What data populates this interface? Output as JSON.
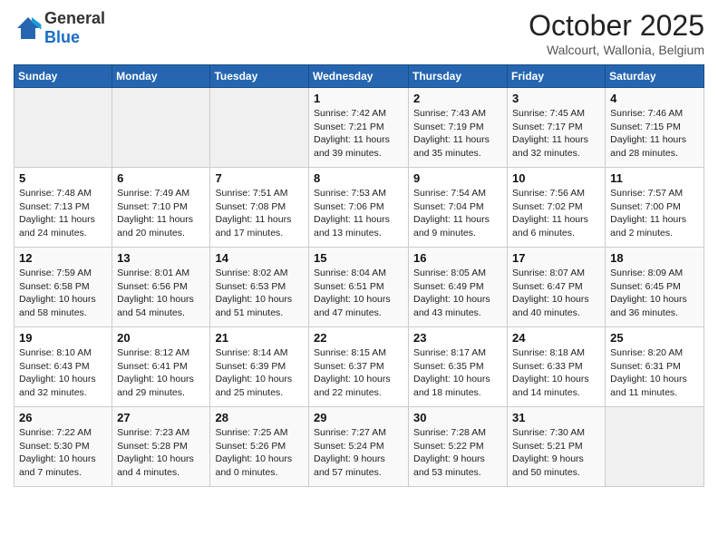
{
  "header": {
    "logo_general": "General",
    "logo_blue": "Blue",
    "month_title": "October 2025",
    "subtitle": "Walcourt, Wallonia, Belgium"
  },
  "days_of_week": [
    "Sunday",
    "Monday",
    "Tuesday",
    "Wednesday",
    "Thursday",
    "Friday",
    "Saturday"
  ],
  "weeks": [
    [
      {
        "day": "",
        "info": ""
      },
      {
        "day": "",
        "info": ""
      },
      {
        "day": "",
        "info": ""
      },
      {
        "day": "1",
        "info": "Sunrise: 7:42 AM\nSunset: 7:21 PM\nDaylight: 11 hours\nand 39 minutes."
      },
      {
        "day": "2",
        "info": "Sunrise: 7:43 AM\nSunset: 7:19 PM\nDaylight: 11 hours\nand 35 minutes."
      },
      {
        "day": "3",
        "info": "Sunrise: 7:45 AM\nSunset: 7:17 PM\nDaylight: 11 hours\nand 32 minutes."
      },
      {
        "day": "4",
        "info": "Sunrise: 7:46 AM\nSunset: 7:15 PM\nDaylight: 11 hours\nand 28 minutes."
      }
    ],
    [
      {
        "day": "5",
        "info": "Sunrise: 7:48 AM\nSunset: 7:13 PM\nDaylight: 11 hours\nand 24 minutes."
      },
      {
        "day": "6",
        "info": "Sunrise: 7:49 AM\nSunset: 7:10 PM\nDaylight: 11 hours\nand 20 minutes."
      },
      {
        "day": "7",
        "info": "Sunrise: 7:51 AM\nSunset: 7:08 PM\nDaylight: 11 hours\nand 17 minutes."
      },
      {
        "day": "8",
        "info": "Sunrise: 7:53 AM\nSunset: 7:06 PM\nDaylight: 11 hours\nand 13 minutes."
      },
      {
        "day": "9",
        "info": "Sunrise: 7:54 AM\nSunset: 7:04 PM\nDaylight: 11 hours\nand 9 minutes."
      },
      {
        "day": "10",
        "info": "Sunrise: 7:56 AM\nSunset: 7:02 PM\nDaylight: 11 hours\nand 6 minutes."
      },
      {
        "day": "11",
        "info": "Sunrise: 7:57 AM\nSunset: 7:00 PM\nDaylight: 11 hours\nand 2 minutes."
      }
    ],
    [
      {
        "day": "12",
        "info": "Sunrise: 7:59 AM\nSunset: 6:58 PM\nDaylight: 10 hours\nand 58 minutes."
      },
      {
        "day": "13",
        "info": "Sunrise: 8:01 AM\nSunset: 6:56 PM\nDaylight: 10 hours\nand 54 minutes."
      },
      {
        "day": "14",
        "info": "Sunrise: 8:02 AM\nSunset: 6:53 PM\nDaylight: 10 hours\nand 51 minutes."
      },
      {
        "day": "15",
        "info": "Sunrise: 8:04 AM\nSunset: 6:51 PM\nDaylight: 10 hours\nand 47 minutes."
      },
      {
        "day": "16",
        "info": "Sunrise: 8:05 AM\nSunset: 6:49 PM\nDaylight: 10 hours\nand 43 minutes."
      },
      {
        "day": "17",
        "info": "Sunrise: 8:07 AM\nSunset: 6:47 PM\nDaylight: 10 hours\nand 40 minutes."
      },
      {
        "day": "18",
        "info": "Sunrise: 8:09 AM\nSunset: 6:45 PM\nDaylight: 10 hours\nand 36 minutes."
      }
    ],
    [
      {
        "day": "19",
        "info": "Sunrise: 8:10 AM\nSunset: 6:43 PM\nDaylight: 10 hours\nand 32 minutes."
      },
      {
        "day": "20",
        "info": "Sunrise: 8:12 AM\nSunset: 6:41 PM\nDaylight: 10 hours\nand 29 minutes."
      },
      {
        "day": "21",
        "info": "Sunrise: 8:14 AM\nSunset: 6:39 PM\nDaylight: 10 hours\nand 25 minutes."
      },
      {
        "day": "22",
        "info": "Sunrise: 8:15 AM\nSunset: 6:37 PM\nDaylight: 10 hours\nand 22 minutes."
      },
      {
        "day": "23",
        "info": "Sunrise: 8:17 AM\nSunset: 6:35 PM\nDaylight: 10 hours\nand 18 minutes."
      },
      {
        "day": "24",
        "info": "Sunrise: 8:18 AM\nSunset: 6:33 PM\nDaylight: 10 hours\nand 14 minutes."
      },
      {
        "day": "25",
        "info": "Sunrise: 8:20 AM\nSunset: 6:31 PM\nDaylight: 10 hours\nand 11 minutes."
      }
    ],
    [
      {
        "day": "26",
        "info": "Sunrise: 7:22 AM\nSunset: 5:30 PM\nDaylight: 10 hours\nand 7 minutes."
      },
      {
        "day": "27",
        "info": "Sunrise: 7:23 AM\nSunset: 5:28 PM\nDaylight: 10 hours\nand 4 minutes."
      },
      {
        "day": "28",
        "info": "Sunrise: 7:25 AM\nSunset: 5:26 PM\nDaylight: 10 hours\nand 0 minutes."
      },
      {
        "day": "29",
        "info": "Sunrise: 7:27 AM\nSunset: 5:24 PM\nDaylight: 9 hours\nand 57 minutes."
      },
      {
        "day": "30",
        "info": "Sunrise: 7:28 AM\nSunset: 5:22 PM\nDaylight: 9 hours\nand 53 minutes."
      },
      {
        "day": "31",
        "info": "Sunrise: 7:30 AM\nSunset: 5:21 PM\nDaylight: 9 hours\nand 50 minutes."
      },
      {
        "day": "",
        "info": ""
      }
    ]
  ]
}
